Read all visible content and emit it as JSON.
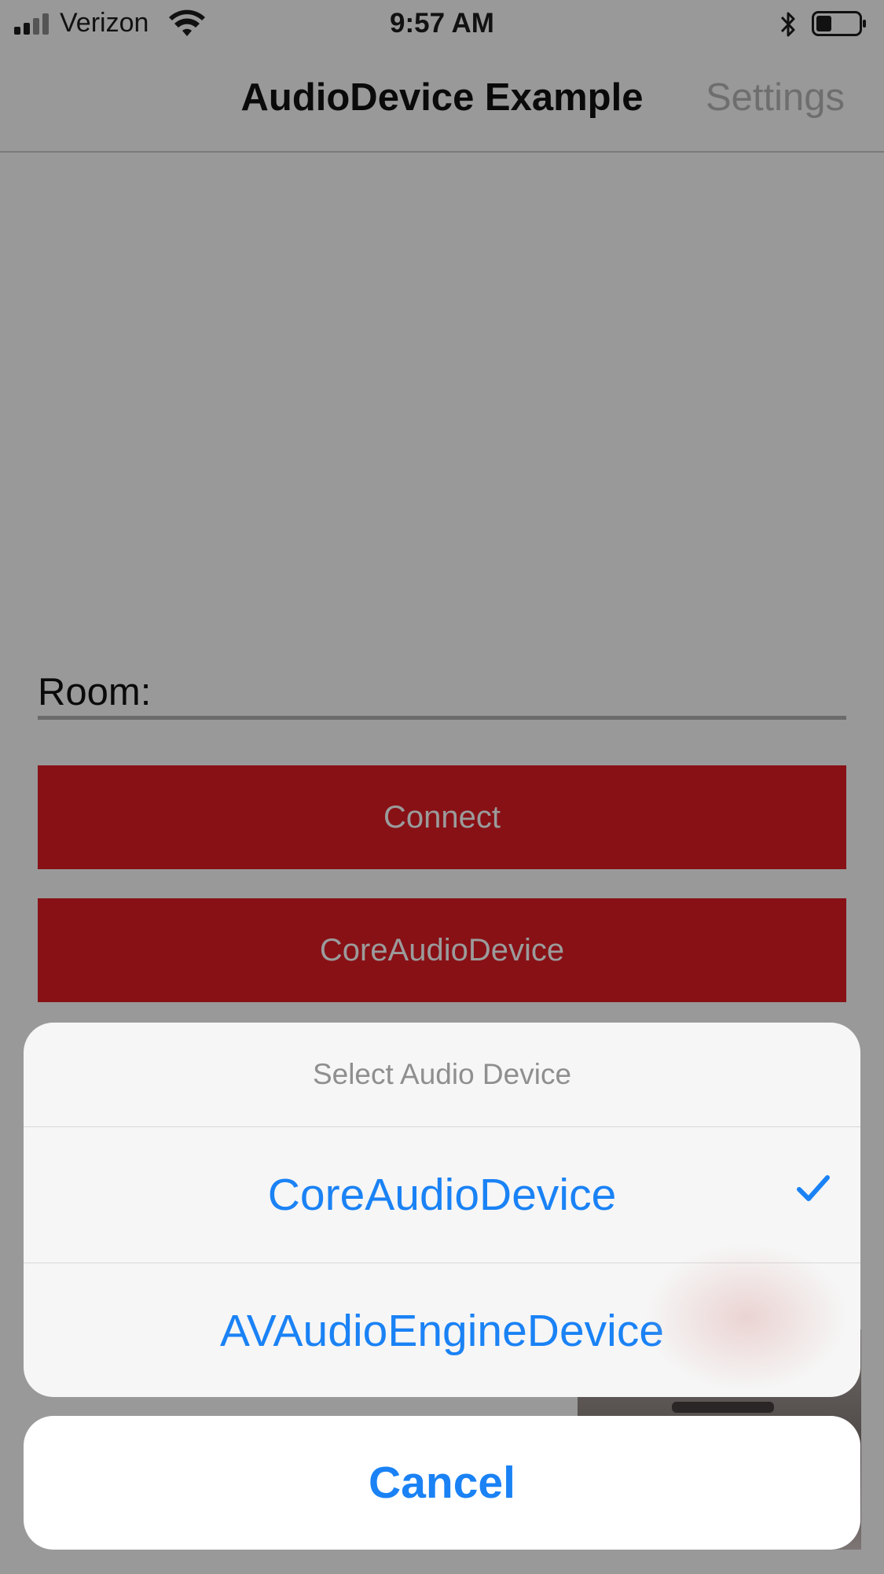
{
  "status_bar": {
    "carrier": "Verizon",
    "time": "9:57 AM",
    "icons": [
      "signal-icon",
      "wifi-icon",
      "bluetooth-icon",
      "battery-icon"
    ]
  },
  "nav": {
    "title": "AudioDevice Example",
    "settings_label": "Settings"
  },
  "room": {
    "label": "Room:",
    "value": ""
  },
  "buttons": {
    "connect_label": "Connect",
    "audio_device_label": "CoreAudioDevice"
  },
  "action_sheet": {
    "title": "Select Audio Device",
    "options": [
      {
        "label": "CoreAudioDevice",
        "selected": true
      },
      {
        "label": "AVAudioEngineDevice",
        "selected": false
      }
    ],
    "cancel_label": "Cancel"
  },
  "colors": {
    "accent": "#1a82f5",
    "button_red": "#881116",
    "dimmed_background": "#999999"
  }
}
